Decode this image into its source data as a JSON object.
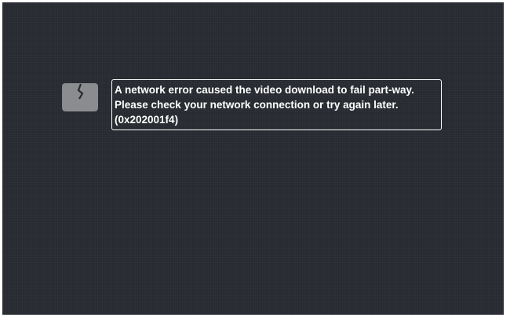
{
  "player": {
    "background_color": "#272a30",
    "error": {
      "icon": "broken-screen-icon",
      "icon_color": "#8b8c90",
      "lines": [
        "A network error caused the video download to fail part-way.",
        "Please check your network connection or try again later.",
        "(0x202001f4)"
      ]
    }
  }
}
